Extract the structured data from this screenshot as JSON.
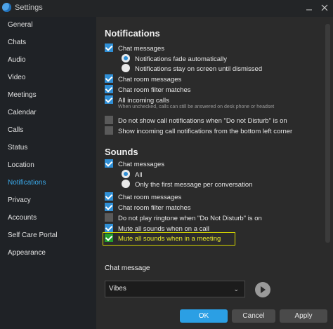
{
  "window": {
    "title": "Settings"
  },
  "sidebar": {
    "items": [
      {
        "label": "General"
      },
      {
        "label": "Chats"
      },
      {
        "label": "Audio"
      },
      {
        "label": "Video"
      },
      {
        "label": "Meetings"
      },
      {
        "label": "Calendar"
      },
      {
        "label": "Calls"
      },
      {
        "label": "Status"
      },
      {
        "label": "Location"
      },
      {
        "label": "Notifications",
        "active": true
      },
      {
        "label": "Privacy"
      },
      {
        "label": "Accounts"
      },
      {
        "label": "Self Care Portal"
      },
      {
        "label": "Appearance"
      }
    ]
  },
  "notifications": {
    "heading": "Notifications",
    "chat_messages": {
      "label": "Chat messages",
      "checked": true
    },
    "fade_auto": {
      "label": "Notifications fade automatically",
      "selected": true
    },
    "stay_on_screen": {
      "label": "Notifications stay on screen until dismissed",
      "selected": false
    },
    "chat_room_messages": {
      "label": "Chat room messages",
      "checked": true
    },
    "chat_room_filter": {
      "label": "Chat room filter matches",
      "checked": true
    },
    "incoming_calls": {
      "label": "All incoming calls",
      "checked": true,
      "hint": "When unchecked, calls can still be answered on desk phone or headset"
    },
    "no_dnd_calls": {
      "label": "Do not show call notifications when \"Do not Disturb\" is on",
      "checked": false
    },
    "bottom_left": {
      "label": "Show incoming call notifications from the bottom left corner",
      "checked": false
    }
  },
  "sounds": {
    "heading": "Sounds",
    "chat_messages": {
      "label": "Chat messages",
      "checked": true
    },
    "all": {
      "label": "All",
      "selected": true
    },
    "first_message": {
      "label": "Only the first message per conversation",
      "selected": false
    },
    "chat_room_messages": {
      "label": "Chat room messages",
      "checked": true
    },
    "chat_room_filter": {
      "label": "Chat room filter matches",
      "checked": true
    },
    "no_ringtone_dnd": {
      "label": "Do not play ringtone when \"Do Not Disturb\" is on",
      "checked": false
    },
    "mute_on_call": {
      "label": "Mute all sounds when on a call",
      "checked": true
    },
    "mute_in_meeting": {
      "label": "Mute all sounds when in a meeting",
      "checked": true
    }
  },
  "chat_message": {
    "heading": "Chat message",
    "sound_value": "Vibes"
  },
  "footer": {
    "ok": "OK",
    "cancel": "Cancel",
    "apply": "Apply"
  },
  "colors": {
    "accent": "#2b9fe4",
    "highlight": "#ecec2a",
    "sidebar_bg": "#1f2226",
    "main_bg": "#2b2b2b"
  },
  "icons": [
    "app-logo-icon",
    "close-icon",
    "checkbox-icon",
    "radio-icon",
    "chevron-down-icon",
    "play-icon"
  ]
}
